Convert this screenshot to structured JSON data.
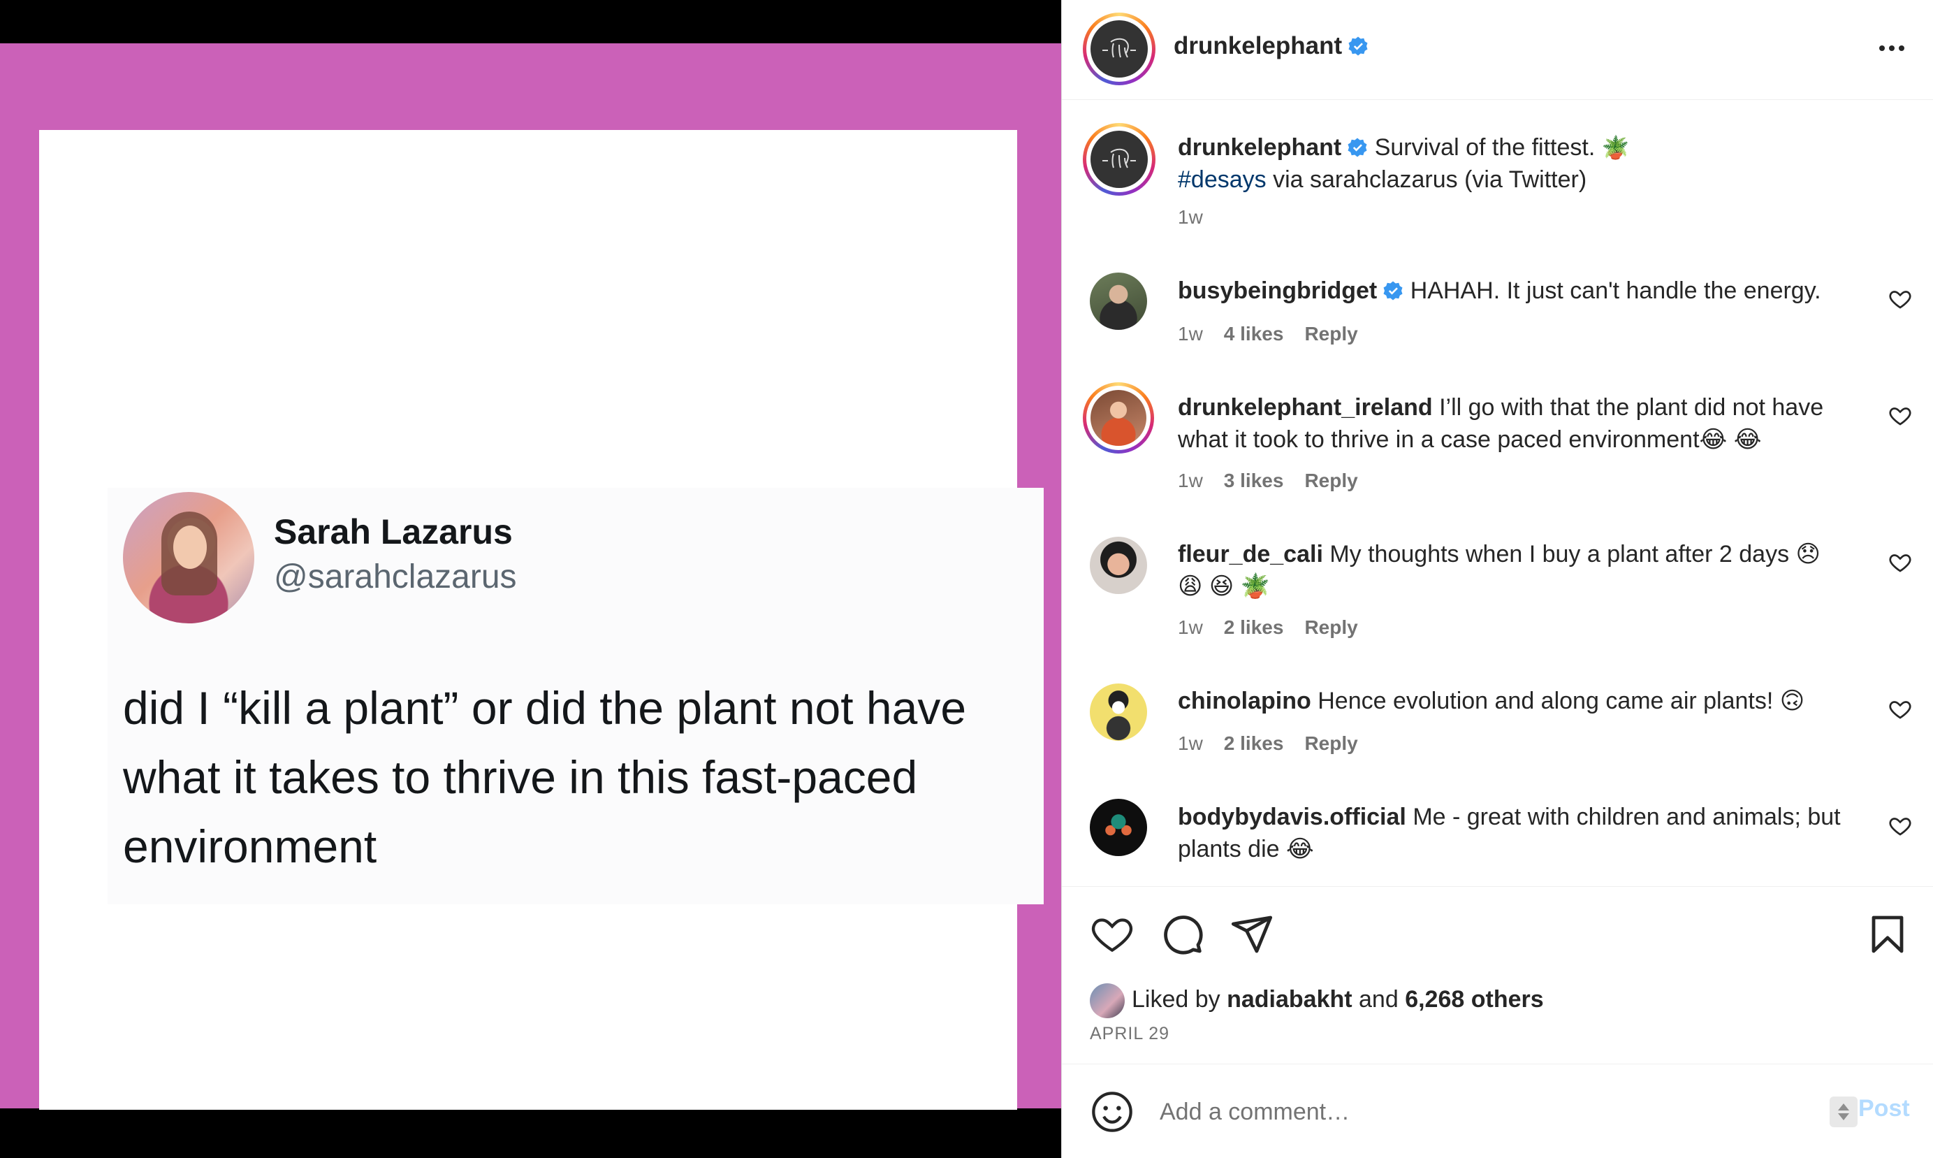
{
  "tweet": {
    "name": "Sarah Lazarus",
    "handle": "@sarahclazarus",
    "text": "did I “kill a plant” or did the plant not have what it takes to thrive in this fast-paced environment"
  },
  "colors": {
    "frame": "#cb61b8",
    "verified": "#3897f0",
    "link": "#00376b",
    "muted": "#737373",
    "post_disabled": "#b3dbff"
  },
  "header": {
    "username": "drunkelephant",
    "more_icon": "ellipsis-icon"
  },
  "caption": {
    "username": "drunkelephant",
    "text_before": "Survival of the fittest. ",
    "emoji": "🪴",
    "hashtag": "#desays",
    "text_after": " via sarahclazarus (via Twitter)",
    "time": "1w"
  },
  "comments": [
    {
      "username": "busybeingbridget",
      "verified": true,
      "text": "HAHAH. It just can't handle the energy.",
      "time": "1w",
      "likes": "4 likes",
      "reply": "Reply"
    },
    {
      "username": "drunkelephant_ireland",
      "verified": false,
      "text": "I’ll go with that the plant did not have what it took to thrive in a case paced environment😂 😂",
      "time": "1w",
      "likes": "3 likes",
      "reply": "Reply"
    },
    {
      "username": "fleur_de_cali",
      "verified": false,
      "text": "My thoughts when I buy a plant after 2 days 😞 😩 😆 🪴",
      "time": "1w",
      "likes": "2 likes",
      "reply": "Reply"
    },
    {
      "username": "chinolapino",
      "verified": false,
      "text": "Hence evolution and along came air plants! 🙃",
      "time": "1w",
      "likes": "2 likes",
      "reply": "Reply"
    },
    {
      "username": "bodybydavis.official",
      "verified": false,
      "text": "Me - great with children and animals; but plants die 😂"
    }
  ],
  "actions": {
    "like_icon": "heart-icon",
    "comment_icon": "comment-icon",
    "share_icon": "paper-plane-icon",
    "save_icon": "bookmark-icon"
  },
  "likes": {
    "prefix": "Liked by ",
    "user": "nadiabakht",
    "middle": " and ",
    "others": "6,268 others"
  },
  "date": "APRIL 29",
  "add_comment": {
    "placeholder": "Add a comment…",
    "post_label": "Post"
  }
}
